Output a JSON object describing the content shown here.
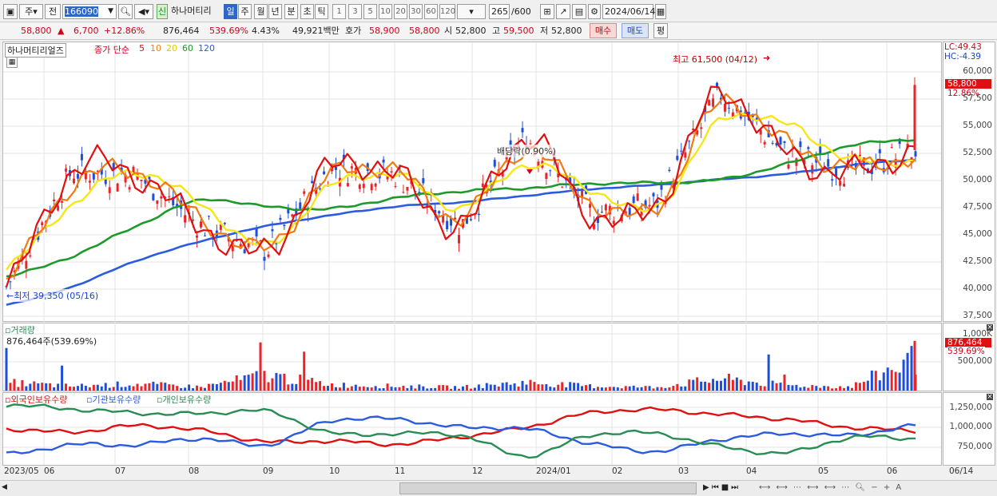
{
  "toolbar": {
    "type_label": "주",
    "prev_label": "전",
    "stock_code": "166090",
    "badge": "신",
    "stock_name": "하나머티리",
    "periods": [
      "일",
      "주",
      "월",
      "년",
      "분",
      "초",
      "틱"
    ],
    "intervals": [
      "1",
      "3",
      "5",
      "10",
      "20",
      "30",
      "60",
      "120"
    ],
    "count": "265",
    "count_total": "/600",
    "date": "2024/06/14"
  },
  "quote": {
    "price": "58,800",
    "change_arrow": "▲",
    "change": "6,700",
    "change_pct": "+12.86%",
    "volume": "876,464",
    "volume_ratio": "539.69%",
    "turnover": "4.43%",
    "amount": "49,921백만",
    "hoga_label": "호가",
    "ask": "58,900",
    "bid": "58,800",
    "open_label": "시",
    "open": "52,800",
    "high_label": "고",
    "high": "59,500",
    "low_label": "저",
    "low": "52,800",
    "buy_label": "매수",
    "sell_label": "매도",
    "eval_label": "평"
  },
  "price_panel": {
    "stock_label": "하나머티리얼즈",
    "ma_title": "종가 단순",
    "ma_periods": [
      "5",
      "10",
      "20",
      "60",
      "120"
    ],
    "high_annotation": "최고 61,500 (04/12)",
    "low_annotation": "최저 39,350 (05/16)",
    "dividend_annotation": "배당락(0.90%)",
    "lc": "LC:49.43",
    "hc": "HC:-4.39",
    "current_price": "58,800",
    "current_pct": "12.86%",
    "axis_ticks": [
      "60,000",
      "57,500",
      "55,000",
      "52,500",
      "50,000",
      "47,500",
      "45,000",
      "42,500",
      "40,000",
      "37,500"
    ]
  },
  "volume_panel": {
    "title": "거래량",
    "value": "876,464주(539.69%)",
    "current": "876,464",
    "current_pct": "539.69%",
    "axis_ticks": [
      "1,000K",
      "500,000"
    ]
  },
  "holdings_panel": {
    "legend": [
      "외국인보유수량",
      "기관보유수량",
      "개인보유수량"
    ],
    "axis_ticks": [
      "1,250,000",
      "1,000,000",
      "750,000"
    ]
  },
  "x_axis": {
    "labels": [
      "2023/05",
      "06",
      "07",
      "08",
      "09",
      "10",
      "11",
      "12",
      "2024/01",
      "02",
      "03",
      "04",
      "05",
      "06"
    ],
    "last_date": "06/14"
  },
  "colors": {
    "up": "#e8262a",
    "down": "#1f4fd8",
    "ma5": "#e01010",
    "ma10": "#f07c10",
    "ma20": "#f5e61a",
    "ma60": "#1c9a2a",
    "ma120": "#2a5be0",
    "foreign": "#e01010",
    "inst": "#2a5be0",
    "retail": "#2a8c55"
  },
  "chart_data": [
    {
      "type": "line",
      "title": "종가 단순",
      "x": [
        "2023/05",
        "06",
        "07",
        "08",
        "09",
        "10",
        "11",
        "12",
        "2024/01",
        "02",
        "03",
        "04",
        "05",
        "06",
        "06/14"
      ],
      "series": [
        {
          "name": "5",
          "values": [
            40200,
            50800,
            50500,
            45800,
            43500,
            51200,
            50500,
            45800,
            54000,
            47000,
            47800,
            58000,
            52500,
            50800,
            52800
          ]
        },
        {
          "name": "10",
          "values": [
            41000,
            49500,
            50800,
            46500,
            43800,
            50500,
            50800,
            46500,
            53000,
            48000,
            47500,
            57200,
            53500,
            51200,
            52200
          ]
        },
        {
          "name": "20",
          "values": [
            42000,
            47800,
            50800,
            47800,
            44000,
            49500,
            50500,
            47500,
            51500,
            49200,
            47500,
            55500,
            55200,
            52000,
            51800
          ]
        },
        {
          "name": "60",
          "values": [
            41200,
            43000,
            45800,
            48200,
            47600,
            47400,
            48400,
            49000,
            49300,
            49700,
            49800,
            50100,
            51500,
            53200,
            53800
          ]
        },
        {
          "name": "120",
          "values": [
            38600,
            40200,
            42600,
            44400,
            45800,
            46800,
            47600,
            48000,
            48600,
            49200,
            49600,
            50100,
            50600,
            51400,
            51900
          ]
        }
      ],
      "ylim": [
        37500,
        61500
      ]
    },
    {
      "type": "bar",
      "title": "거래량",
      "x": [
        "2023/05",
        "06",
        "07",
        "08",
        "09",
        "10",
        "11",
        "12",
        "2024/01",
        "02",
        "03",
        "04",
        "05",
        "06",
        "06/14"
      ],
      "values": [
        220000,
        120000,
        180000,
        100000,
        420000,
        160000,
        120000,
        90000,
        220000,
        120000,
        90000,
        320000,
        140000,
        100000,
        876464
      ],
      "ylim": [
        0,
        1000000
      ]
    },
    {
      "type": "line",
      "x": [
        "2023/05",
        "06",
        "07",
        "08",
        "09",
        "10",
        "11",
        "12",
        "2024/01",
        "02",
        "03",
        "04",
        "05",
        "06",
        "06/14"
      ],
      "series": [
        {
          "name": "외국인보유수량",
          "values": [
            980000,
            940000,
            1020000,
            960000,
            820000,
            830000,
            790000,
            880000,
            1000000,
            1180000,
            1220000,
            1160000,
            1100000,
            1000000,
            960000
          ]
        },
        {
          "name": "기관보유수량",
          "values": [
            660000,
            780000,
            780000,
            860000,
            780000,
            1080000,
            1100000,
            1000000,
            980000,
            800000,
            700000,
            850000,
            920000,
            900000,
            1020000
          ]
        },
        {
          "name": "개인보유수량",
          "values": [
            1280000,
            1230000,
            1180000,
            1170000,
            1200000,
            930000,
            920000,
            900000,
            640000,
            900000,
            920000,
            760000,
            680000,
            870000,
            860000
          ]
        }
      ],
      "ylim": [
        600000,
        1300000
      ]
    }
  ]
}
